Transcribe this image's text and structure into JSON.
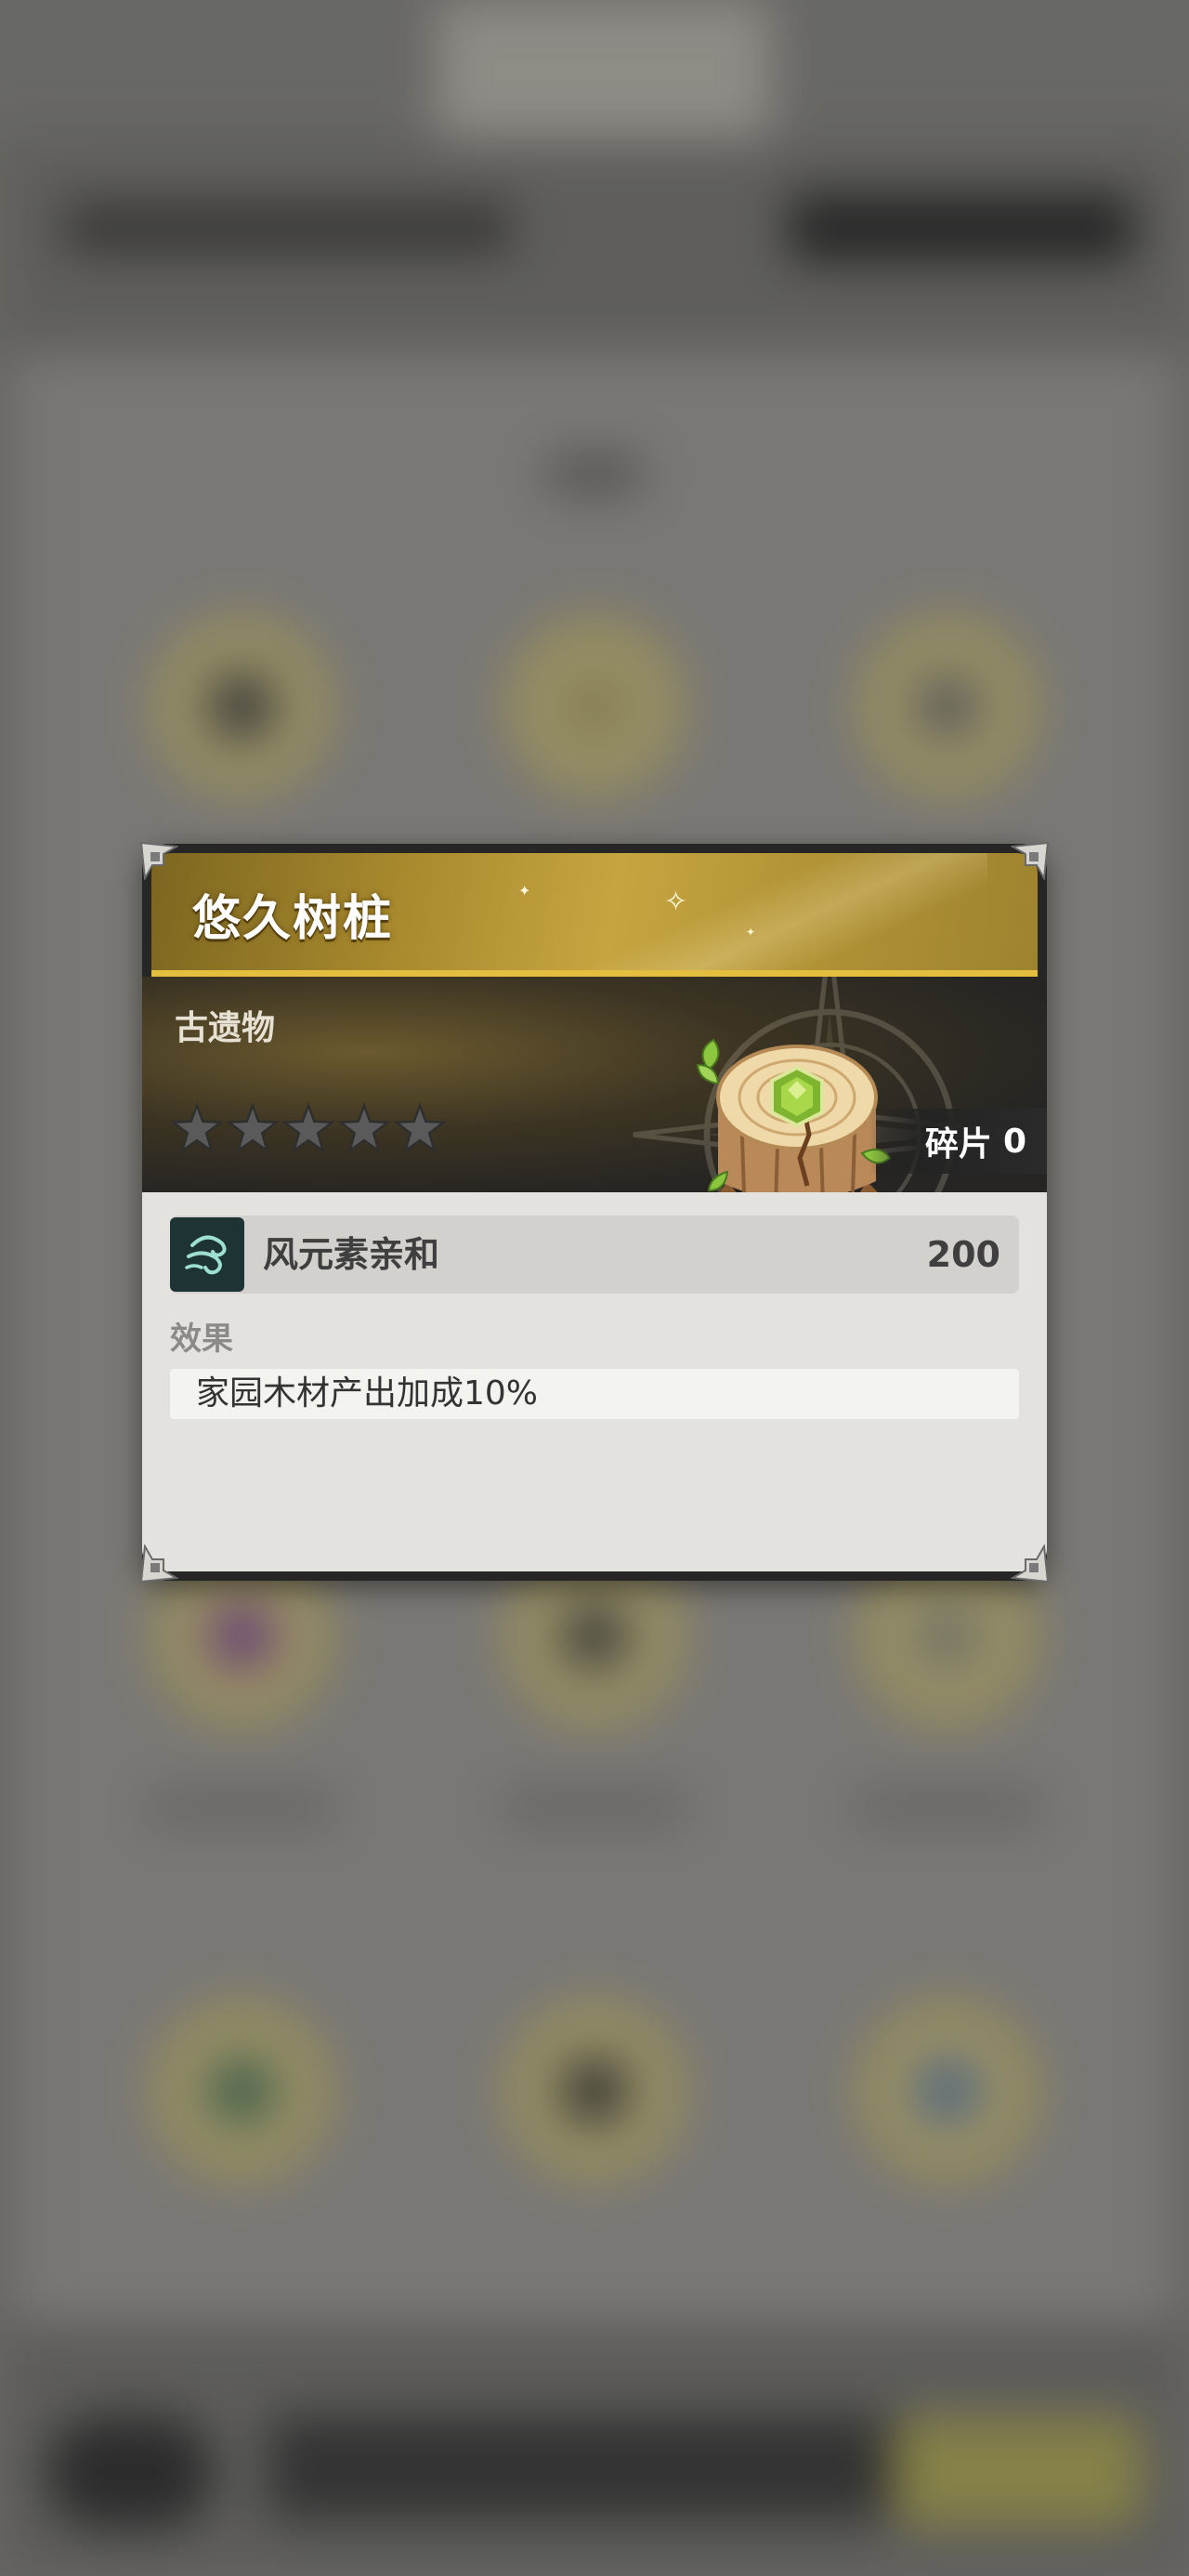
{
  "item": {
    "name": "悠久树桩",
    "category": "古遗物",
    "star_count": 5,
    "stars_filled": 0,
    "fragment_label": "碎片",
    "fragment_count": "0"
  },
  "attribute": {
    "icon": "wind-element-icon",
    "name": "风元素亲和",
    "value": "200"
  },
  "effect": {
    "label": "效果",
    "text": "家园木材产出加成10%"
  },
  "colors": {
    "header_gold": "#c6a540",
    "header_border": "#e4bf3f",
    "card_dark": "#262626",
    "footer_bg": "#e3e2df",
    "attr_icon_bg": "#1e3434"
  }
}
